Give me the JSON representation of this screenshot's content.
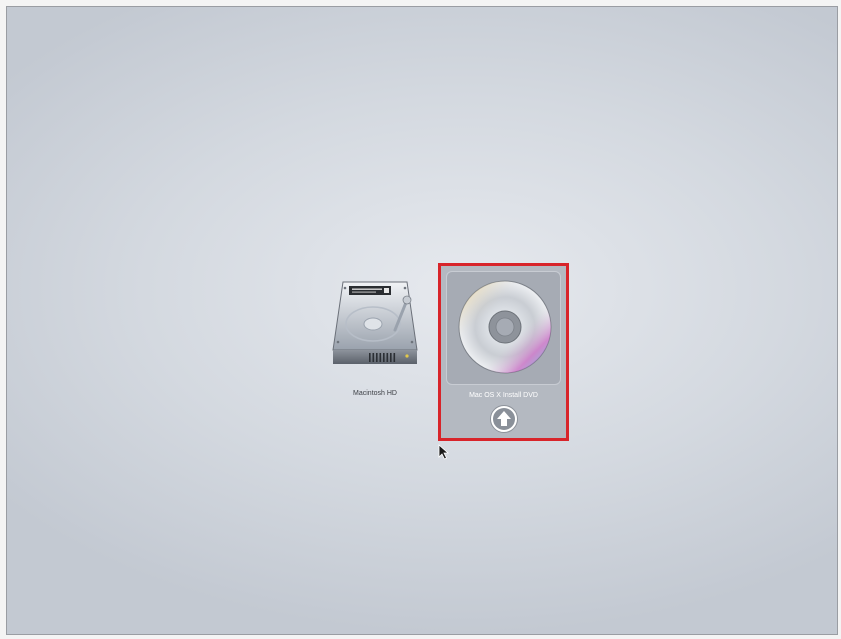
{
  "startup_manager": {
    "volumes": [
      {
        "label": "Macintosh HD",
        "icon": "hard-drive-icon",
        "selected": false
      },
      {
        "label": "Mac OS X Install DVD",
        "icon": "dvd-icon",
        "selected": true
      }
    ],
    "boot_action_icon": "up-arrow-icon"
  },
  "colors": {
    "selection_highlight": "#d8242a",
    "background": "#d4d9e0"
  }
}
